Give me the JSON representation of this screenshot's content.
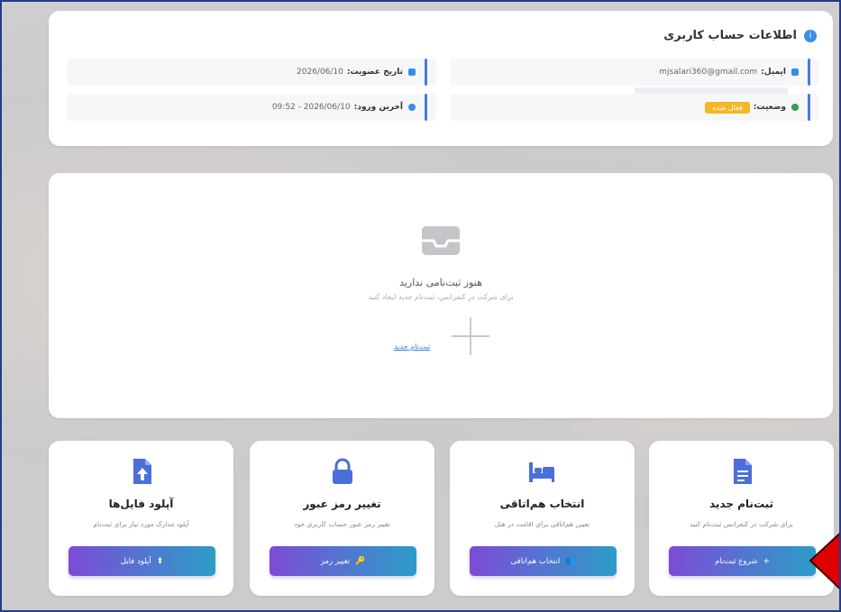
{
  "account": {
    "title": "اطلاعات حساب کاربری",
    "fields": [
      {
        "label": "ایمیل:",
        "value": "mjsalari360@gmail.com"
      },
      {
        "label": "تاریخ عضویت:",
        "value": "2026/06/10"
      },
      {
        "label": "وضعیت:",
        "value": "فعال شده"
      },
      {
        "label": "آخرین ورود:",
        "value": "2026/06/10 - 09:52"
      }
    ]
  },
  "empty": {
    "title": "هنوز ثبت‌نامی ندارید",
    "subtitle": "برای شرکت در کنفرانس، ثبت‌نام جدید ایجاد کنید",
    "link": "ثبت‌نام جدید"
  },
  "actions": [
    {
      "title": "ثبت‌نام جدید",
      "desc": "برای شرکت در کنفرانس ثبت‌نام کنید",
      "button": "شروع ثبت‌نام",
      "icon": "document-icon"
    },
    {
      "title": "انتخاب هم‌اتاقی",
      "desc": "تعیین هم‌اتاقی برای اقامت در هتل",
      "button": "انتخاب هم‌اتاقی",
      "icon": "bed-icon"
    },
    {
      "title": "تغییر رمز عبور",
      "desc": "تغییر رمز عبور حساب کاربری خود",
      "button": "تغییر رمز",
      "icon": "lock-icon"
    },
    {
      "title": "آپلود فایل‌ها",
      "desc": "آپلود مدارک مورد نیاز برای ثبت‌نام",
      "button": "آپلود فایل",
      "icon": "upload-file-icon"
    }
  ],
  "colors": {
    "accent": "#4a7ae0",
    "badge": "#f3b728",
    "pointer": "#e00000"
  }
}
